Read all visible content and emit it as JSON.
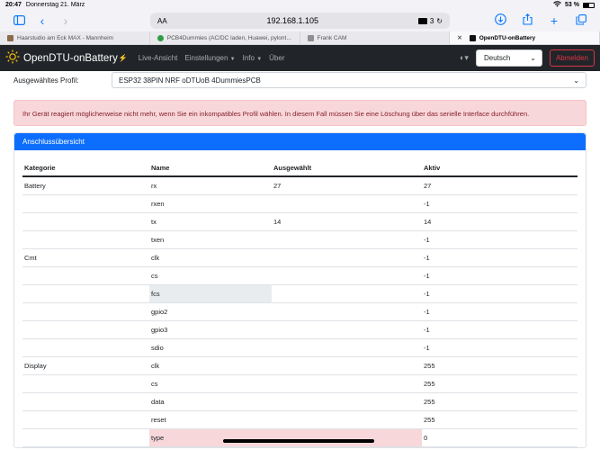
{
  "statusbar": {
    "time": "20:47",
    "date": "Donnerstag 21. März",
    "battery": "53 %"
  },
  "browser": {
    "url": "192.168.1.105",
    "aa": "AA",
    "extensions_count": "3",
    "tabs": [
      {
        "title": "Haarstudio am Eck MAX - Mannheim",
        "color": "#8b6b4a"
      },
      {
        "title": "PCB4Dummies (AC/DC laden, Huawei, pylont...",
        "color": "#2e9e44"
      },
      {
        "title": "Frank CAM",
        "color": "#8f8f8f"
      },
      {
        "title": "OpenDTU-onBattery",
        "color": "#111111"
      }
    ]
  },
  "navbar": {
    "brand": "OpenDTU-onBattery",
    "links": [
      "Live-Ansicht",
      "Einstellungen",
      "Info",
      "Über"
    ],
    "language": "Deutsch",
    "logout": "Abmelden"
  },
  "profile": {
    "label": "Ausgewähltes Profil:",
    "value": "ESP32 38PIN NRF oDTUoB 4DummiesPCB"
  },
  "alert": "Ihr Gerät reagiert möglicherweise nicht mehr, wenn Sie ein inkompatibles Profil wählen. In diesem Fall müssen Sie eine Löschung über das serielle Interface durchführen.",
  "card": {
    "title": "Anschlussübersicht",
    "columns": [
      "Kategorie",
      "Name",
      "Ausgewählt",
      "Aktiv"
    ],
    "rows": [
      {
        "category": "Battery",
        "name": "rx",
        "selected": "27",
        "active": "27",
        "hl": ""
      },
      {
        "category": "",
        "name": "rxen",
        "selected": "",
        "active": "-1",
        "hl": ""
      },
      {
        "category": "",
        "name": "tx",
        "selected": "14",
        "active": "14",
        "hl": ""
      },
      {
        "category": "",
        "name": "txen",
        "selected": "",
        "active": "-1",
        "hl": ""
      },
      {
        "category": "Cmt",
        "name": "clk",
        "selected": "",
        "active": "-1",
        "hl": ""
      },
      {
        "category": "",
        "name": "cs",
        "selected": "",
        "active": "-1",
        "hl": ""
      },
      {
        "category": "",
        "name": "fcs",
        "selected": "",
        "active": "-1",
        "hl": "grey"
      },
      {
        "category": "",
        "name": "gpio2",
        "selected": "",
        "active": "-1",
        "hl": ""
      },
      {
        "category": "",
        "name": "gpio3",
        "selected": "",
        "active": "-1",
        "hl": ""
      },
      {
        "category": "",
        "name": "sdio",
        "selected": "",
        "active": "-1",
        "hl": ""
      },
      {
        "category": "Display",
        "name": "clk",
        "selected": "",
        "active": "255",
        "hl": ""
      },
      {
        "category": "",
        "name": "cs",
        "selected": "",
        "active": "255",
        "hl": ""
      },
      {
        "category": "",
        "name": "data",
        "selected": "",
        "active": "255",
        "hl": ""
      },
      {
        "category": "",
        "name": "reset",
        "selected": "",
        "active": "255",
        "hl": ""
      },
      {
        "category": "",
        "name": "type",
        "selected": "",
        "active": "0",
        "hl": "red"
      }
    ]
  }
}
